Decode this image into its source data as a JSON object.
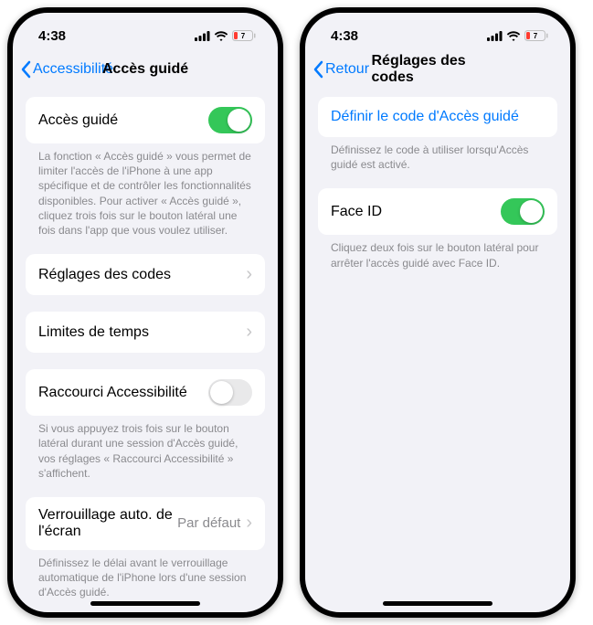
{
  "status": {
    "time": "4:38"
  },
  "left": {
    "back_label": "Accessibilité",
    "title": "Accès guidé",
    "main_toggle": {
      "label": "Accès guidé",
      "on": true
    },
    "main_footer": "La fonction « Accès guidé » vous permet de limiter l'accès de l'iPhone à une app spécifique et de contrôler les fonctionnalités disponibles. Pour activer « Accès guidé », cliquez trois fois sur le bouton latéral une fois dans l'app que vous voulez utiliser.",
    "row_codes": "Réglages des codes",
    "row_timelimits": "Limites de temps",
    "shortcut_toggle": {
      "label": "Raccourci Accessibilité",
      "on": false
    },
    "shortcut_footer": "Si vous appuyez trois fois sur le bouton latéral durant une session d'Accès guidé, vos réglages « Raccourci Accessibilité » s'affichent.",
    "autolock": {
      "label": "Verrouillage auto. de l'écran",
      "value": "Par défaut"
    },
    "autolock_footer": "Définissez le délai avant le verrouillage automatique de l'iPhone lors d'une session d'Accès guidé."
  },
  "right": {
    "back_label": "Retour",
    "title": "Réglages des codes",
    "row_define": "Définir le code d'Accès guidé",
    "define_footer": "Définissez le code à utiliser lorsqu'Accès guidé est activé.",
    "faceid_toggle": {
      "label": "Face ID",
      "on": true
    },
    "faceid_footer": "Cliquez deux fois sur le bouton latéral pour arrêter l'accès guidé avec Face ID."
  }
}
